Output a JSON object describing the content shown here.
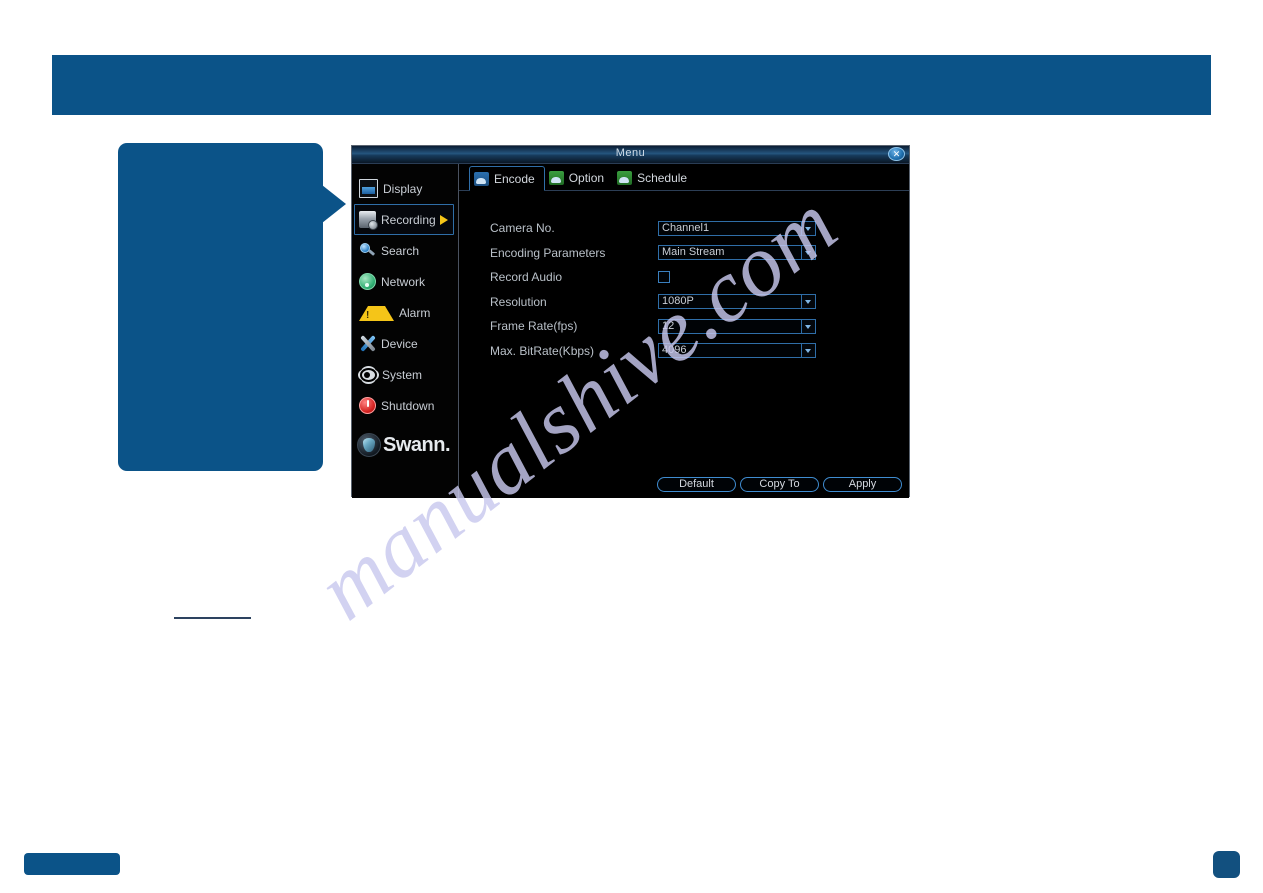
{
  "page": {
    "watermark": "manualshive.com"
  },
  "callout": {
    "text": ""
  },
  "window": {
    "title": "Menu",
    "close_label": "✕"
  },
  "sidebar": {
    "items": [
      {
        "label": "Display",
        "icon": "display-icon",
        "active": false
      },
      {
        "label": "Recording",
        "icon": "recording-icon",
        "active": true
      },
      {
        "label": "Search",
        "icon": "search-icon",
        "active": false
      },
      {
        "label": "Network",
        "icon": "network-icon",
        "active": false
      },
      {
        "label": "Alarm",
        "icon": "alarm-icon",
        "active": false
      },
      {
        "label": "Device",
        "icon": "device-icon",
        "active": false
      },
      {
        "label": "System",
        "icon": "system-icon",
        "active": false
      },
      {
        "label": "Shutdown",
        "icon": "shutdown-icon",
        "active": false
      }
    ],
    "brand": "Swann."
  },
  "tabs": [
    {
      "label": "Encode",
      "icon": "picture-icon",
      "active": true
    },
    {
      "label": "Option",
      "icon": "picture-icon",
      "active": false
    },
    {
      "label": "Schedule",
      "icon": "picture-icon",
      "active": false
    }
  ],
  "form": {
    "rows": [
      {
        "label": "Camera No.",
        "type": "combo",
        "value": "Channel1"
      },
      {
        "label": "Encoding Parameters",
        "type": "combo",
        "value": "Main Stream"
      },
      {
        "label": "Record Audio",
        "type": "checkbox",
        "value": "",
        "checked": false
      },
      {
        "label": "Resolution",
        "type": "combo",
        "value": "1080P"
      },
      {
        "label": "Frame Rate(fps)",
        "type": "combo",
        "value": "12"
      },
      {
        "label": "Max. BitRate(Kbps)",
        "type": "combo",
        "value": "4096"
      }
    ]
  },
  "buttons": {
    "default_label": "Default",
    "copy_to_label": "Copy To",
    "apply_label": "Apply"
  },
  "colors": {
    "brand_blue": "#0b5388",
    "accent_border": "#2f6ea8",
    "arrow_yellow": "#f5c518",
    "window_bg": "#000000"
  }
}
